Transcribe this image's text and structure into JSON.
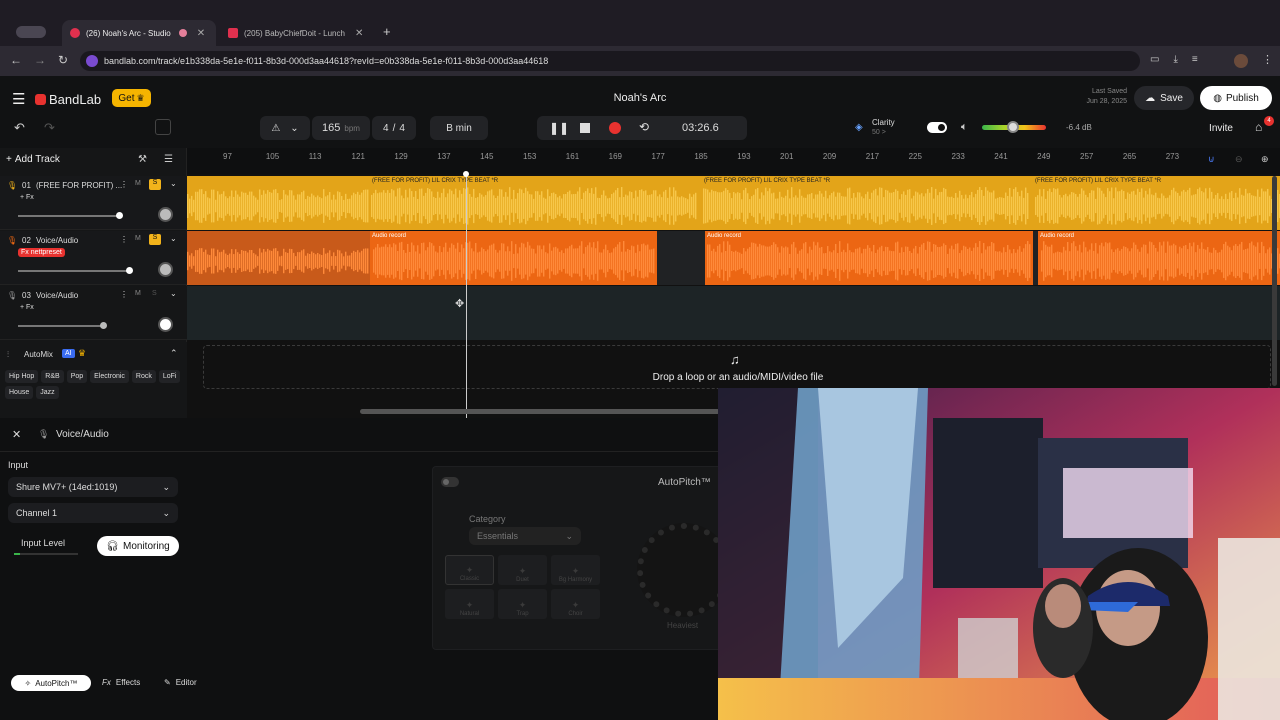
{
  "browser": {
    "tabs": [
      {
        "label": "(26) Noah's Arc - Studio",
        "active": true,
        "color": "#e0304e"
      },
      {
        "label": "(205) BabyChiefDoit - Lunch",
        "active": false,
        "color": "#e0304e"
      }
    ],
    "url": "bandlab.com/track/e1b338da-5e1e-f011-8b3d-000d3aa44618?revId=e0b338da-5e1e-f011-8b3d-000d3aa44618"
  },
  "app": {
    "brand": "BandLab",
    "get_label": "Get",
    "project_title": "Noah's Arc",
    "last_saved_label": "Last Saved",
    "last_saved_date": "Jun 28, 2025",
    "save_label": "Save",
    "publish_label": "Publish",
    "invite_label": "Invite",
    "notification_count": "4"
  },
  "transport": {
    "bpm": "165",
    "bpm_unit": "bpm",
    "time_sig_num": "4",
    "time_sig_sep": "/",
    "time_sig_den": "4",
    "key": "B min",
    "time": "03:26.6",
    "clarity_label": "Clarity",
    "clarity_value": "50 >",
    "volume_db": "-6.4 dB"
  },
  "toolbar": {
    "add_track": "Add Track"
  },
  "ruler": [
    "97",
    "105",
    "113",
    "121",
    "129",
    "137",
    "145",
    "153",
    "161",
    "169",
    "177",
    "185",
    "193",
    "201",
    "209",
    "217",
    "225",
    "233",
    "241",
    "249",
    "257",
    "265",
    "273"
  ],
  "tracks": [
    {
      "num": "01",
      "name": "(FREE FOR PROFIT) ...",
      "fx": "+ Fx",
      "m": "M",
      "s": "S",
      "clip_label": "(FREE FOR PROFIT) LIL CRIX TYPE BEAT *R"
    },
    {
      "num": "02",
      "name": "Voice/Audio",
      "fx": "Fx nettpreset",
      "m": "M",
      "s": "S",
      "clip_label": "Audio record"
    },
    {
      "num": "03",
      "name": "Voice/Audio",
      "fx": "+ Fx",
      "m": "M",
      "s": "S",
      "clip_label": ""
    }
  ],
  "automix": {
    "label": "AutoMix",
    "badge": "AI",
    "genres": [
      "Hip Hop",
      "R&B",
      "Pop",
      "Electronic",
      "Rock",
      "LoFi",
      "House",
      "Jazz"
    ]
  },
  "dropzone": {
    "text": "Drop a loop or an audio/MIDI/video file"
  },
  "lower_panel": {
    "track_name": "Voice/Audio",
    "input_label": "Input",
    "input_device": "Shure MV7+ (14ed:1019)",
    "channel": "Channel 1",
    "input_level_label": "Input Level",
    "monitoring_label": "Monitoring",
    "autopitch_title": "AutoPitch™",
    "category_label": "Category",
    "category_value": "Essentials",
    "effects": [
      "Classic",
      "Duet",
      "Bg Harmony",
      "Natural",
      "Trap",
      "Choir"
    ],
    "knob_label": "Heaviest",
    "bottom_tabs": [
      "AutoPitch™",
      "Effects",
      "Editor"
    ]
  },
  "colors": {
    "beat_clip": "#f2b31b",
    "voice_clip": "#f46a12",
    "accent_red": "#e8322f",
    "get_badge": "#f5b400"
  }
}
